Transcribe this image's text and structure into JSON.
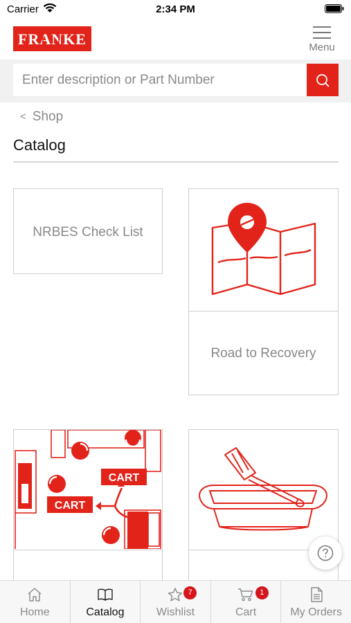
{
  "status_bar": {
    "carrier": "Carrier",
    "time": "2:34 PM"
  },
  "header": {
    "logo_text": "FRANKE",
    "menu_label": "Menu"
  },
  "search": {
    "placeholder": "Enter description or Part Number"
  },
  "breadcrumb": {
    "chevron": "<",
    "parent": "Shop"
  },
  "page": {
    "title": "Catalog"
  },
  "catalog": {
    "items": [
      {
        "label": "NRBES Check List",
        "image": "none"
      },
      {
        "label": "Road to Recovery",
        "image": "map-pin-icon"
      },
      {
        "label": "",
        "image": "kitchen-floorplan-carts"
      },
      {
        "label": "",
        "image": "baking-dish-spatula"
      }
    ],
    "cart_labels": [
      "CART",
      "CART"
    ]
  },
  "tabs": [
    {
      "label": "Home",
      "icon": "home-icon",
      "active": false
    },
    {
      "label": "Catalog",
      "icon": "book-icon",
      "active": true
    },
    {
      "label": "Wishlist",
      "icon": "star-icon",
      "badge": "7"
    },
    {
      "label": "Cart",
      "icon": "cart-icon",
      "badge": "1"
    },
    {
      "label": "My Orders",
      "icon": "document-icon"
    }
  ],
  "colors": {
    "brand_red": "#e2231a",
    "badge_red": "#d4161c",
    "text_gray": "#8a8a8a"
  }
}
